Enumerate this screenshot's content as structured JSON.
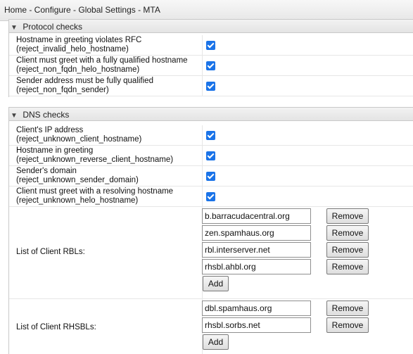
{
  "breadcrumb": "Home - Configure - Global Settings - MTA",
  "protocol_checks": {
    "title": "Protocol checks",
    "rows": [
      {
        "line1": "Hostname in greeting violates RFC",
        "line2": "(reject_invalid_helo_hostname)",
        "checked": true
      },
      {
        "line1": "Client must greet with a fully qualified hostname",
        "line2": "(reject_non_fqdn_helo_hostname)",
        "checked": true
      },
      {
        "line1": "Sender address must be fully qualified",
        "line2": "(reject_non_fqdn_sender)",
        "checked": true
      }
    ]
  },
  "dns_checks": {
    "title": "DNS checks",
    "rows": [
      {
        "line1": "Client's IP address",
        "line2": "(reject_unknown_client_hostname)",
        "checked": true
      },
      {
        "line1": "Hostname in greeting",
        "line2": "(reject_unknown_reverse_client_hostname)",
        "checked": true
      },
      {
        "line1": "Sender's domain",
        "line2": "(reject_unknown_sender_domain)",
        "checked": true
      },
      {
        "line1": "Client must greet with a resolving hostname",
        "line2": "(reject_unknown_helo_hostname)",
        "checked": true
      }
    ],
    "client_rbls": {
      "label": "List of Client RBLs:",
      "items": [
        "b.barracudacentral.org",
        "zen.spamhaus.org",
        "rbl.interserver.net",
        "rhsbl.ahbl.org"
      ]
    },
    "client_rhsbls": {
      "label": "List of Client RHSBLs:",
      "items": [
        "dbl.spamhaus.org",
        "rhsbl.sorbs.net"
      ]
    },
    "remove_label": "Remove",
    "add_label": "Add"
  }
}
